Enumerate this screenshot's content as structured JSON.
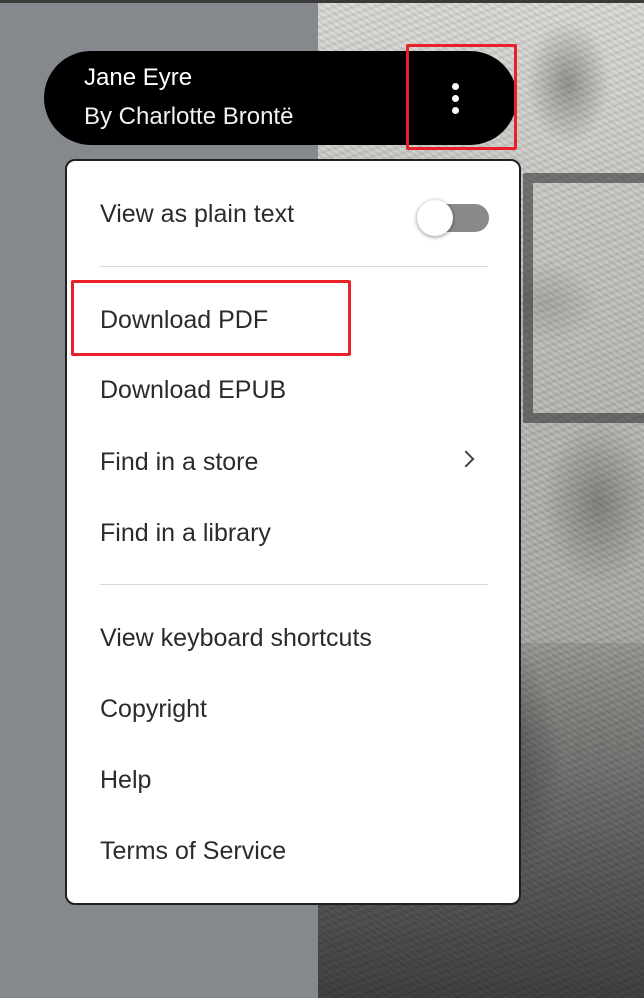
{
  "book": {
    "title": "Jane Eyre",
    "author": "By Charlotte Brontë"
  },
  "header": {
    "more_icon": "more-vert-icon"
  },
  "menu": {
    "plain_text_label": "View as plain text",
    "plain_text_toggle_on": false,
    "download_pdf": "Download PDF",
    "download_epub": "Download EPUB",
    "find_in_store": "Find in a store",
    "find_in_library": "Find in a library",
    "keyboard_shortcuts": "View keyboard shortcuts",
    "copyright": "Copyright",
    "help": "Help",
    "terms": "Terms of Service"
  },
  "colors": {
    "highlight": "#e8202a",
    "header_bg": "#000000",
    "menu_bg": "#ffffff",
    "left_background": "#85888c",
    "toggle_track": "#8a8a8a"
  }
}
